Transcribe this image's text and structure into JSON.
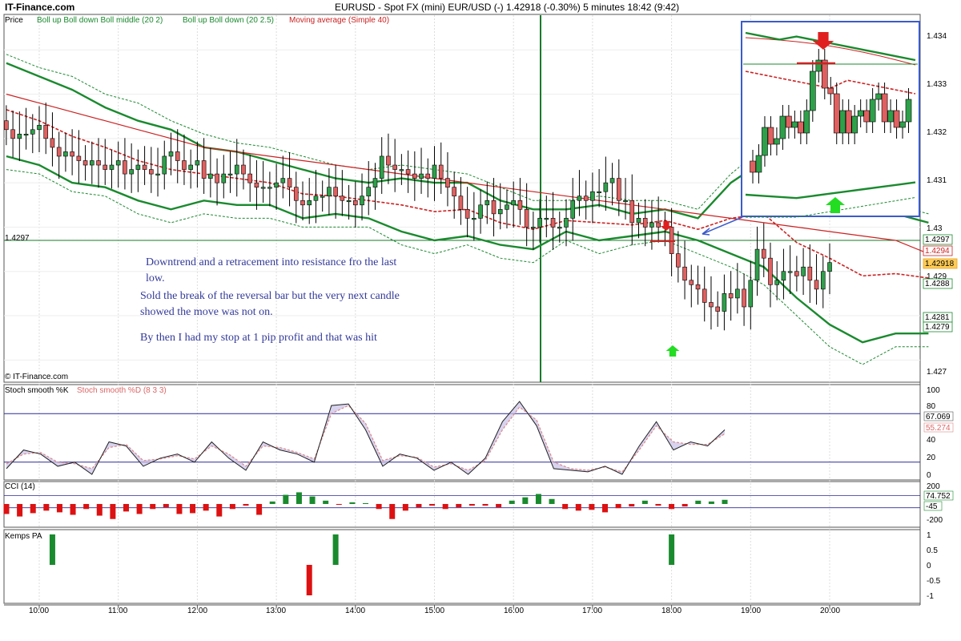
{
  "header": {
    "brand": "IT-Finance.com",
    "title": "EURUSD - Spot FX (mini) EUR/USD (-)   1.42918 (-0.30%)    5 minutes  18:42 (9:42)",
    "watermark": "© IT-Finance.com"
  },
  "colors": {
    "candle_up": "#2ea04a",
    "candle_down": "#e06060",
    "boll": "#1a8a2e",
    "ma": "#cc2222",
    "stoch_k": "#222222",
    "stoch_d": "#dd8888",
    "inset_border": "#3b5bcc"
  },
  "price_panel": {
    "legend": [
      "Price",
      "Boll up Boll down Boll middle (20 2)",
      "Boll up Boll down (20 2.5)",
      "Moving average (Simple 40)"
    ],
    "hline_label": "1.4297",
    "yticks": [
      "1.434",
      "1.433",
      "1.432",
      "1.431",
      "1.43",
      "1.429",
      "1.427"
    ],
    "value_tags": [
      "1.4297",
      "1.4294",
      "1.42918",
      "1.4288",
      "1.4281",
      "1.4279"
    ]
  },
  "stoch_panel": {
    "legend": [
      "Stoch smooth %K",
      "Stoch smooth %D (8 3 3)"
    ],
    "yticks": [
      "100",
      "80",
      "40",
      "20",
      "0"
    ],
    "value_tags": [
      "67.069",
      "55.274"
    ]
  },
  "cci_panel": {
    "legend": "CCI (14)",
    "yticks": [
      "200",
      "-200"
    ],
    "value_tags": [
      "74.752",
      "-45"
    ]
  },
  "kemps_panel": {
    "legend": "Kemps PA",
    "yticks": [
      "1",
      "0.5",
      "0",
      "-0.5",
      "-1"
    ]
  },
  "xaxis": {
    "labels": [
      "10:00",
      "11:00",
      "12:00",
      "13:00",
      "14:00",
      "15:00",
      "16:00",
      "17:00",
      "18:00",
      "19:00",
      "20:00"
    ]
  },
  "annotations": {
    "lines": [
      "Downtrend and a retracement into resistance fro the last",
      "low.",
      "Sold the break of the reversal bar but the very next candle",
      "showed the move was not on.",
      "By then I had my stop at 1 pip profit and that was hit"
    ]
  },
  "chart_data": [
    {
      "type": "candlestick",
      "title": "EURUSD - Spot FX (mini) EUR/USD (-)   1.42918 (-0.30%)    5 minutes  18:42 (9:42)",
      "x_start": "09:35",
      "interval_minutes": 5,
      "ylim": [
        1.4265,
        1.4348
      ],
      "close": [
        1.4322,
        1.432,
        1.4321,
        1.4321,
        1.4322,
        1.4323,
        1.432,
        1.4318,
        1.4316,
        1.4317,
        1.4316,
        1.4315,
        1.4314,
        1.4315,
        1.4314,
        1.4313,
        1.4314,
        1.4315,
        1.4312,
        1.4313,
        1.4314,
        1.4313,
        1.4312,
        1.4312,
        1.4316,
        1.4317,
        1.4315,
        1.4313,
        1.4314,
        1.4315,
        1.4311,
        1.4312,
        1.431,
        1.4312,
        1.4312,
        1.4314,
        1.4312,
        1.431,
        1.4309,
        1.4309,
        1.4309,
        1.431,
        1.4311,
        1.4309,
        1.4306,
        1.4305,
        1.4306,
        1.4307,
        1.4307,
        1.4309,
        1.4307,
        1.4306,
        1.4306,
        1.4305,
        1.4307,
        1.4309,
        1.4311,
        1.4316,
        1.4314,
        1.4313,
        1.4313,
        1.4312,
        1.4311,
        1.4312,
        1.4311,
        1.4314,
        1.4311,
        1.4309,
        1.4307,
        1.4304,
        1.4302,
        1.4302,
        1.4305,
        1.4306,
        1.4303,
        1.4304,
        1.4305,
        1.4306,
        1.4304,
        1.43,
        1.43,
        1.4302,
        1.4302,
        1.43,
        1.43,
        1.4302,
        1.4306,
        1.4307,
        1.4306,
        1.4308,
        1.4308,
        1.431,
        1.4311,
        1.4306,
        1.4306,
        1.4301,
        1.4302,
        1.43,
        1.4301,
        1.43,
        1.43,
        1.4294,
        1.4291,
        1.4288,
        1.4287,
        1.4286,
        1.4283,
        1.4282,
        1.4281,
        1.4285,
        1.4284,
        1.4286,
        1.4282,
        1.4288,
        1.4295,
        1.4293,
        1.4287,
        1.4288,
        1.429,
        1.429,
        1.4289,
        1.4291,
        1.4288,
        1.4286,
        1.429,
        1.4292
      ],
      "series": [
        {
          "name": "Boll up Boll down Boll middle (20 2)",
          "upper": [
            1.4337,
            1.4334,
            1.4331,
            1.4327,
            1.4324,
            1.4322,
            1.4318,
            1.4317,
            1.4315,
            1.4313,
            1.4311,
            1.431,
            1.4311,
            1.431,
            1.431,
            1.4306,
            1.4304,
            1.4304,
            1.4305,
            1.4303,
            1.4304,
            1.4302,
            1.431,
            1.4315,
            1.4309,
            1.4308,
            1.4304,
            1.4303,
            1.4301
          ],
          "lower": [
            1.4316,
            1.4314,
            1.431,
            1.4309,
            1.4306,
            1.4304,
            1.4306,
            1.4305,
            1.4305,
            1.4302,
            1.4303,
            1.4302,
            1.4299,
            1.4297,
            1.4298,
            1.4296,
            1.4295,
            1.4299,
            1.4297,
            1.4298,
            1.4299,
            1.4297,
            1.4294,
            1.4291,
            1.4284,
            1.4278,
            1.4274,
            1.4276,
            1.4276
          ]
        },
        {
          "name": "Boll up Boll down (20 2.5)",
          "upper": [
            1.4339,
            1.4336,
            1.4334,
            1.433,
            1.4328,
            1.4324,
            1.4321,
            1.4319,
            1.4318,
            1.4316,
            1.4314,
            1.4313,
            1.4314,
            1.4313,
            1.4312,
            1.4309,
            1.4306,
            1.4306,
            1.4307,
            1.4306,
            1.4306,
            1.4304,
            1.4312,
            1.4318,
            1.4312,
            1.4309,
            1.4306,
            1.4305,
            1.4303
          ],
          "lower": [
            1.4313,
            1.4312,
            1.4308,
            1.4307,
            1.4303,
            1.4301,
            1.4303,
            1.4302,
            1.4302,
            1.43,
            1.43,
            1.43,
            1.4296,
            1.4294,
            1.4296,
            1.4293,
            1.4292,
            1.4297,
            1.4294,
            1.4296,
            1.4297,
            1.4294,
            1.4291,
            1.4287,
            1.428,
            1.4273,
            1.4269,
            1.4273,
            1.4273
          ]
        },
        {
          "name": "Moving average (Simple 40)",
          "values": [
            1.433,
            1.4328,
            1.4326,
            1.4324,
            1.4322,
            1.432,
            1.4318,
            1.4317,
            1.4316,
            1.4315,
            1.4314,
            1.4313,
            1.4312,
            1.4311,
            1.431,
            1.4309,
            1.4308,
            1.4307,
            1.4306,
            1.4305,
            1.4304,
            1.4303,
            1.4302,
            1.4301,
            1.43,
            1.4299,
            1.4298,
            1.4297,
            1.4294
          ]
        }
      ]
    },
    {
      "type": "line",
      "title": "Stoch smooth %K Stoch smooth %D (8 3 3)",
      "ylim": [
        0,
        100
      ],
      "series": [
        {
          "name": "Stoch smooth %K",
          "values": [
            12,
            35,
            30,
            15,
            20,
            5,
            45,
            40,
            15,
            25,
            30,
            20,
            45,
            25,
            10,
            45,
            35,
            30,
            20,
            90,
            92,
            60,
            15,
            30,
            25,
            10,
            20,
            5,
            25,
            70,
            95,
            65,
            12,
            10,
            8,
            15,
            5,
            40,
            70,
            35,
            45,
            40,
            60
          ]
        },
        {
          "name": "Stoch smooth %D (8 3 3)",
          "values": [
            18,
            30,
            32,
            20,
            18,
            12,
            38,
            42,
            22,
            24,
            28,
            24,
            40,
            30,
            15,
            40,
            38,
            32,
            24,
            80,
            90,
            68,
            22,
            28,
            26,
            14,
            18,
            10,
            22,
            60,
            88,
            72,
            20,
            12,
            10,
            14,
            8,
            35,
            65,
            45,
            42,
            42,
            55
          ]
        }
      ]
    },
    {
      "type": "bar",
      "title": "CCI (14)",
      "ylim": [
        -250,
        250
      ],
      "values": [
        -120,
        -150,
        -110,
        -80,
        -100,
        -130,
        -60,
        -140,
        -180,
        -90,
        -120,
        -60,
        -40,
        -120,
        -110,
        -80,
        -150,
        -60,
        -20,
        -130,
        30,
        110,
        140,
        90,
        40,
        -10,
        20,
        10,
        -60,
        -180,
        -80,
        -40,
        -20,
        -60,
        -40,
        -20,
        -20,
        -40,
        40,
        80,
        120,
        60,
        -60,
        -80,
        -70,
        -100,
        -50,
        -30,
        40,
        -20,
        -60,
        -30,
        40,
        30,
        50
      ]
    },
    {
      "type": "bar",
      "title": "Kemps PA",
      "ylim": [
        -1,
        1
      ],
      "events": [
        {
          "x": "10:10",
          "value": 1
        },
        {
          "x": "13:25",
          "value": -1
        },
        {
          "x": "13:45",
          "value": 1
        },
        {
          "x": "18:00",
          "value": 1
        }
      ]
    }
  ]
}
